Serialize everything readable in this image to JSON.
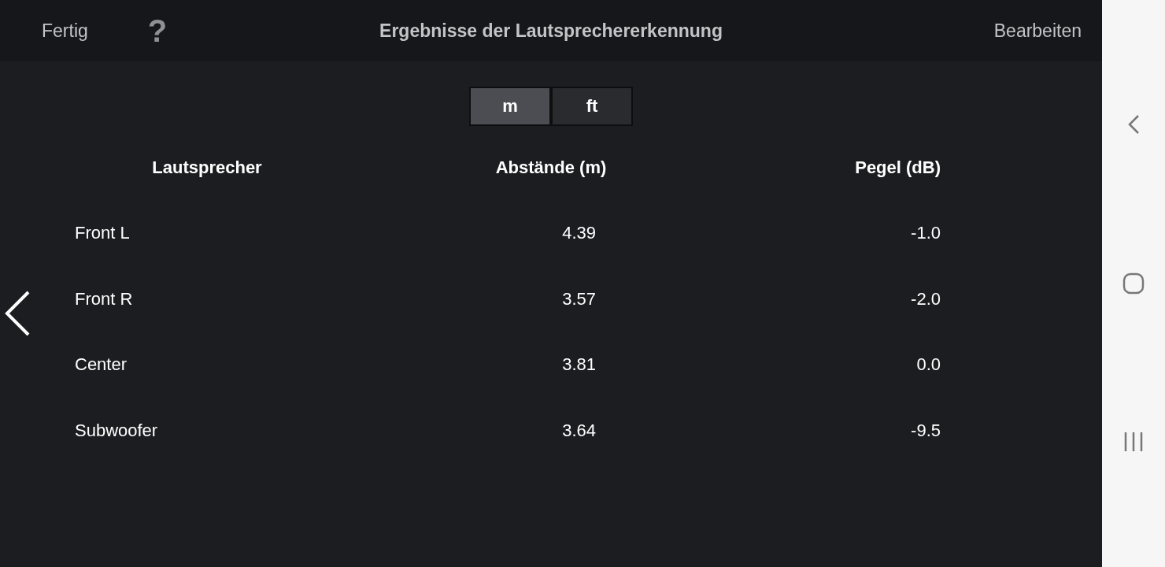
{
  "header": {
    "done_button": "Fertig",
    "help_button": "?",
    "title": "Ergebnisse der Lautsprechererkennung",
    "edit_button": "Bearbeiten"
  },
  "unit_toggle": [
    {
      "label": "m",
      "selected": true
    },
    {
      "label": "ft",
      "selected": false
    }
  ],
  "table": {
    "columns": [
      "Lautsprecher",
      "Abstände (m)",
      "Pegel (dB)"
    ],
    "rows": [
      [
        "Front L",
        "4.39",
        "-1.0"
      ],
      [
        "Front R",
        "3.57",
        "-2.0"
      ],
      [
        "Center",
        "3.81",
        "0.0"
      ],
      [
        "Subwoofer",
        "3.64",
        "-9.5"
      ]
    ]
  }
}
